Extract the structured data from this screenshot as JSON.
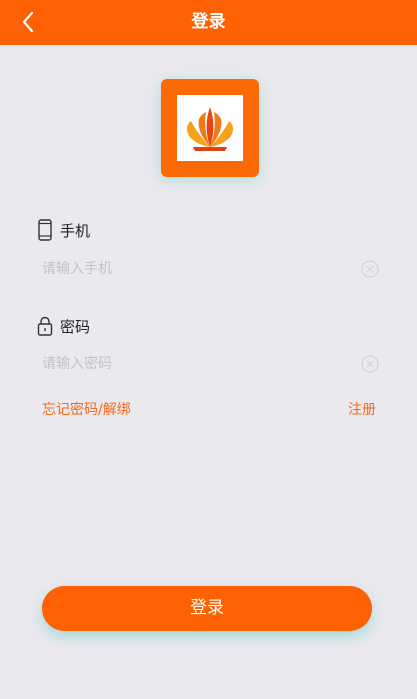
{
  "header": {
    "title": "登录"
  },
  "form": {
    "phone": {
      "label": "手机",
      "placeholder": "请输入手机",
      "value": ""
    },
    "password": {
      "label": "密码",
      "placeholder": "请输入密码",
      "value": ""
    }
  },
  "links": {
    "forgot": "忘记密码/解绑",
    "register": "注册"
  },
  "login_button": {
    "label": "登录"
  },
  "colors": {
    "brand": "#fd6103",
    "link": "#f26a1a",
    "background": "#ebe9ee"
  },
  "icons": {
    "back": "chevron-left-icon",
    "phone": "phone-icon",
    "lock": "lock-icon",
    "clear": "clear-circle-icon",
    "logo": "flower-logo-icon"
  }
}
